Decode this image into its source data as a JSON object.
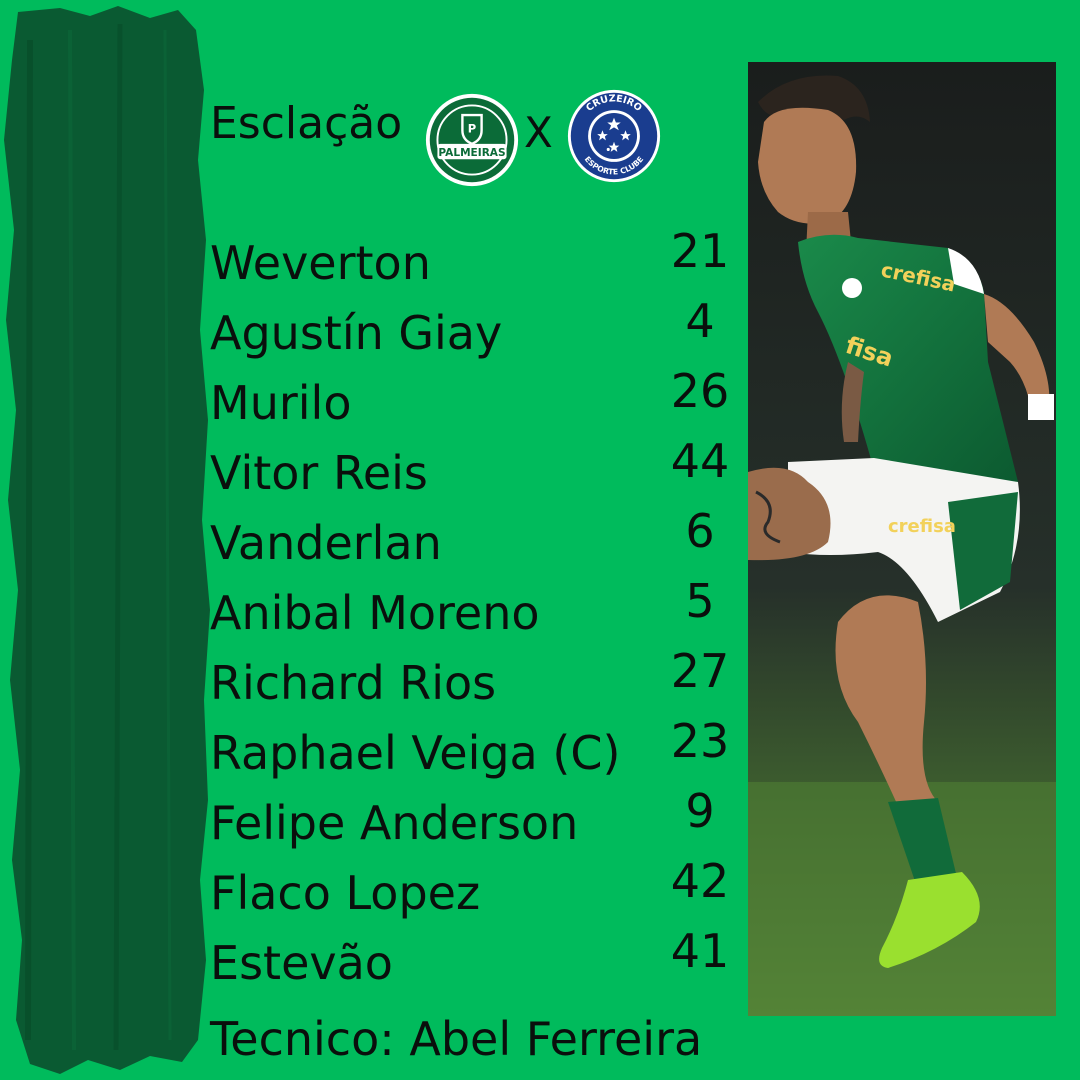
{
  "header": {
    "title": "Esclação",
    "separator": "X",
    "home_crest": {
      "name": "Palmeiras",
      "icon": "palmeiras-crest-icon",
      "text": "PALMEIRAS",
      "color": "#0b6b38"
    },
    "away_crest": {
      "name": "Cruzeiro",
      "icon": "cruzeiro-crest-icon",
      "text_top": "CRUZEIRO",
      "text_bottom": "ESPORTE CLUBE",
      "color": "#1a3d8f"
    }
  },
  "lineup": [
    {
      "name": "Weverton",
      "number": "21"
    },
    {
      "name": "Agustín Giay",
      "number": "4"
    },
    {
      "name": "Murilo",
      "number": "26"
    },
    {
      "name": "Vitor Reis",
      "number": "44"
    },
    {
      "name": "Vanderlan",
      "number": "6"
    },
    {
      "name": "Anibal Moreno",
      "number": "5"
    },
    {
      "name": "Richard Rios",
      "number": "27"
    },
    {
      "name": "Raphael Veiga (C)",
      "number": "23"
    },
    {
      "name": "Felipe Anderson",
      "number": "9"
    },
    {
      "name": "Flaco Lopez",
      "number": "42"
    },
    {
      "name": "Estevão",
      "number": "41"
    }
  ],
  "coach": "Tecnico: Abel Ferreira",
  "colors": {
    "background": "#00bb5c",
    "brush": "#0a5a32",
    "text": "#0a0f0c"
  },
  "photo": {
    "icon": "player-photo",
    "jersey_sponsor": "crefisa"
  }
}
